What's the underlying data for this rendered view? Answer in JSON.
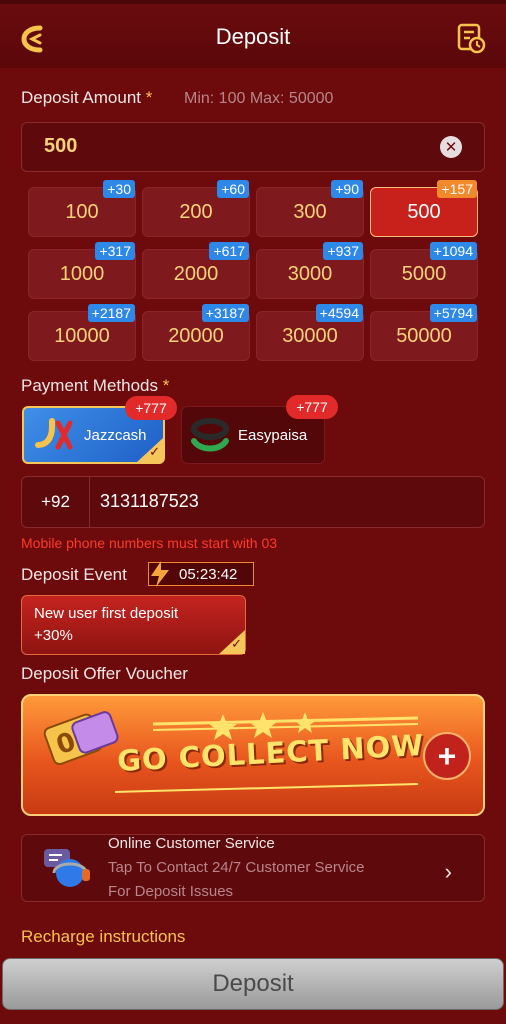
{
  "header": {
    "title": "Deposit",
    "back_icon": "back-arrow-icon",
    "records_icon": "history-icon"
  },
  "amount": {
    "label": "Deposit Amount",
    "required_mark": "*",
    "minmax": "Min: 100  Max: 50000",
    "value": "500",
    "clear_icon": "clear-icon"
  },
  "chips": [
    {
      "amount": "100",
      "bonus": "+30"
    },
    {
      "amount": "200",
      "bonus": "+60"
    },
    {
      "amount": "300",
      "bonus": "+90"
    },
    {
      "amount": "500",
      "bonus": "+157",
      "selected": true
    },
    {
      "amount": "1000",
      "bonus": "+317"
    },
    {
      "amount": "2000",
      "bonus": "+617"
    },
    {
      "amount": "3000",
      "bonus": "+937"
    },
    {
      "amount": "5000",
      "bonus": "+1094"
    },
    {
      "amount": "10000",
      "bonus": "+2187"
    },
    {
      "amount": "20000",
      "bonus": "+3187"
    },
    {
      "amount": "30000",
      "bonus": "+4594"
    },
    {
      "amount": "50000",
      "bonus": "+5794"
    }
  ],
  "payment": {
    "label": "Payment Methods",
    "required_mark": "*",
    "methods": [
      {
        "name": "Jazzcash",
        "badge": "+777",
        "selected": true
      },
      {
        "name": "Easypaisa",
        "badge": "+777",
        "selected": false
      }
    ]
  },
  "phone": {
    "prefix": "+92",
    "value": "3131187523",
    "error": "Mobile phone numbers must start with 03"
  },
  "event": {
    "label": "Deposit Event",
    "timer": "05:23:42",
    "card_line1": "New user first deposit",
    "card_line2": "+30%"
  },
  "voucher": {
    "label": "Deposit Offer Voucher",
    "banner_text": "GO COLLECT NOW"
  },
  "service": {
    "title": "Online Customer Service",
    "line1": "Tap To Contact 24/7 Customer Service",
    "line2": "For Deposit Issues"
  },
  "recharge_link": "Recharge instructions",
  "deposit_button": "Deposit",
  "colors": {
    "accent": "#f6c44b",
    "background": "#6d0a0c",
    "error": "#ff3a2a"
  }
}
